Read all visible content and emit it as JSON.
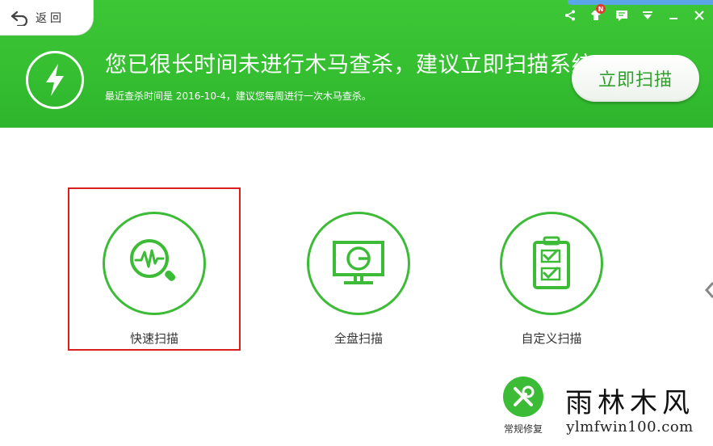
{
  "header": {
    "back_label": "返回",
    "headline": "您已很长时间未进行木马查杀，建议立即扫描系统",
    "subline": "最近查杀时间是 2016-10-4，建议您每周进行一次木马查杀。",
    "scan_now_label": "立即扫描",
    "notification_badge": "N",
    "icons": [
      "share-icon",
      "skin-icon",
      "message-icon",
      "dropdown-menu-icon",
      "minimize-icon",
      "close-icon",
      "bolt-icon"
    ]
  },
  "scan_options": [
    {
      "label": "快速扫描",
      "icon": "magnifier-pulse-icon",
      "selected": true
    },
    {
      "label": "全盘扫描",
      "icon": "monitor-disk-icon",
      "selected": false
    },
    {
      "label": "自定义扫描",
      "icon": "checklist-icon",
      "selected": false
    }
  ],
  "repair": {
    "label": "常规修复",
    "icon": "tools-icon"
  },
  "watermark": {
    "cn": "雨林木风",
    "en": "ylmfwin100.com"
  },
  "colors": {
    "brand_green": "#35bf31",
    "selection_red": "#d9201e",
    "white": "#ffffff"
  }
}
